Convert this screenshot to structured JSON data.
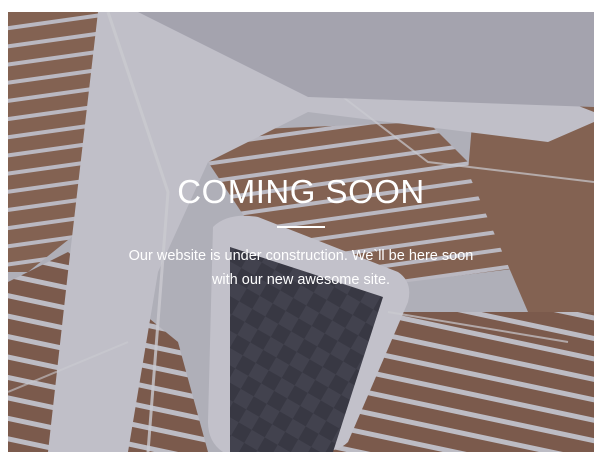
{
  "page": {
    "heading": "COMING SOON",
    "message": "Our website is under construction. We`ll be here soon with our new awesome site."
  },
  "background": {
    "subject": "staircase-photo",
    "overlay_color": "#505064"
  }
}
